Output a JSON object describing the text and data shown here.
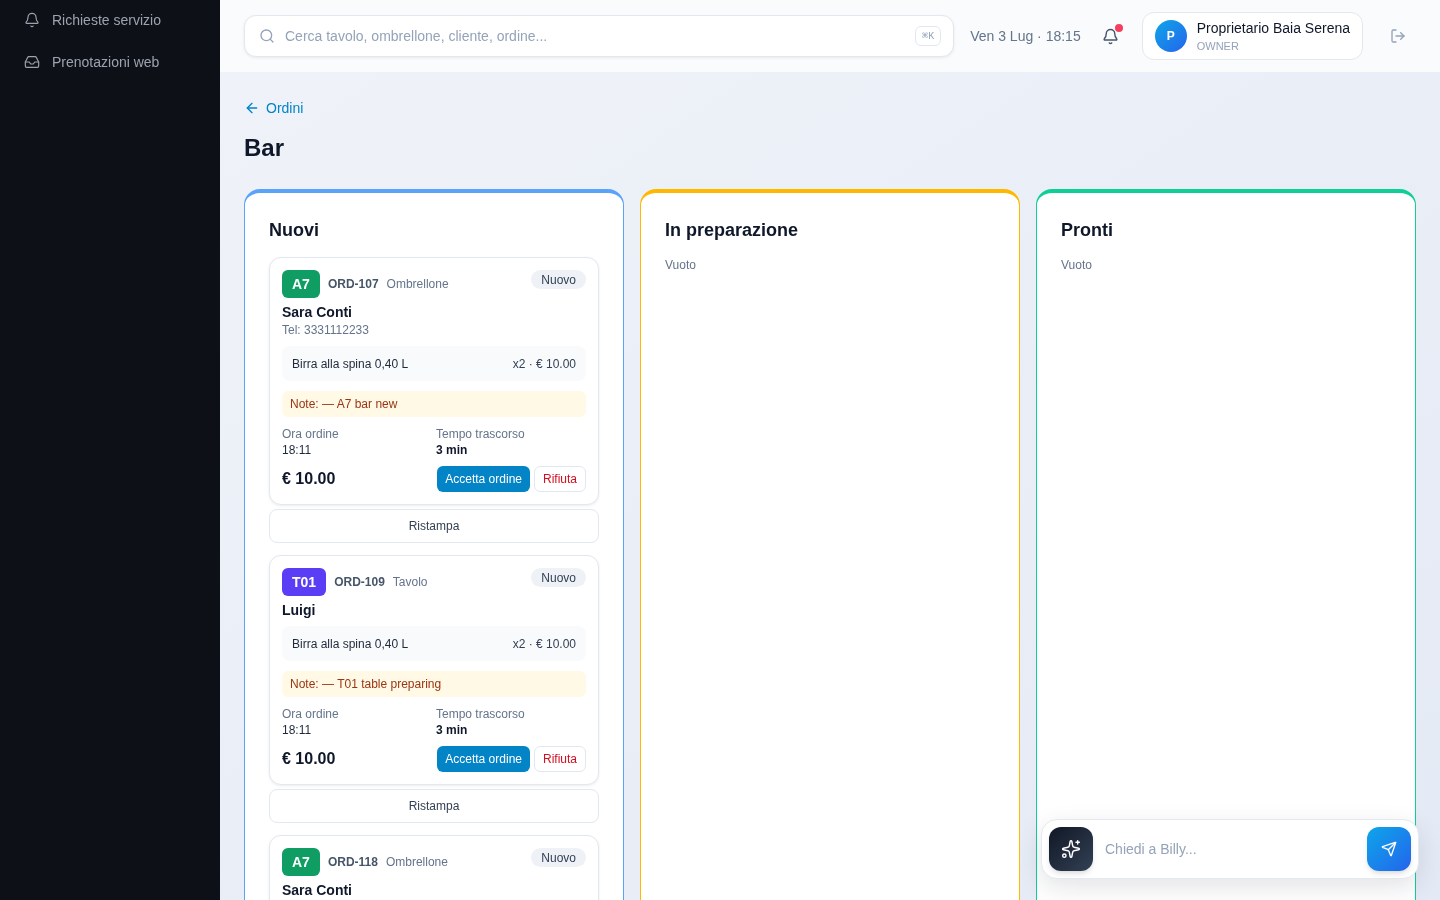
{
  "sidebar": {
    "items": [
      {
        "label": "Richieste servizio"
      },
      {
        "label": "Prenotazioni web"
      }
    ]
  },
  "header": {
    "search": {
      "placeholder": "Cerca tavolo, ombrellone, cliente, ordine...",
      "shortcut": "⌘K"
    },
    "datetime": "Ven 3 Lug · 18:15",
    "notifications": {
      "unread": true
    },
    "user": {
      "initial": "P",
      "name": "Proprietario Baia Serena",
      "role": "OWNER"
    }
  },
  "breadcrumb": {
    "back_link": "Ordini"
  },
  "page_title": "Bar",
  "columns": [
    {
      "title": "Nuovi",
      "color": "#5aa2fa",
      "orders": [
        {
          "badge": "A7",
          "color": "#0f9d63",
          "order_id": "ORD-107",
          "type": "Ombrellone",
          "status": "Nuovo",
          "customer": "Sara Conti",
          "phone": "Tel: 3331112233",
          "items": [
            {
              "name": "Birra alla spina 0,40 L",
              "qty_price": "x2 · € 10.00"
            }
          ],
          "note": "Note: — A7 bar new",
          "order_time": {
            "label": "Ora ordine",
            "value": "18:11"
          },
          "elapsed": {
            "label": "Tempo trascorso",
            "value": "3 min"
          },
          "total": "€ 10.00",
          "actions": [
            {
              "label": "Accetta ordine",
              "kind": "primary"
            },
            {
              "label": "Rifiuta",
              "kind": "danger"
            }
          ],
          "reprint": "Ristampa"
        },
        {
          "badge": "T01",
          "color": "#5a3ef5",
          "order_id": "ORD-109",
          "type": "Tavolo",
          "status": "Nuovo",
          "customer": "Luigi",
          "items": [
            {
              "name": "Birra alla spina 0,40 L",
              "qty_price": "x2 · € 10.00"
            }
          ],
          "note": "Note: — T01 table preparing",
          "order_time": {
            "label": "Ora ordine",
            "value": "18:11"
          },
          "elapsed": {
            "label": "Tempo trascorso",
            "value": "3 min"
          },
          "total": "€ 10.00",
          "actions": [
            {
              "label": "Accetta ordine",
              "kind": "primary"
            },
            {
              "label": "Rifiuta",
              "kind": "danger"
            }
          ],
          "reprint": "Ristampa"
        },
        {
          "badge": "A7",
          "color": "#0f9d63",
          "order_id": "ORD-118",
          "type": "Ombrellone",
          "status": "Nuovo",
          "customer": "Sara Conti"
        }
      ]
    },
    {
      "title": "In preparazione",
      "color": "#ffb800",
      "empty_text": "Vuoto"
    },
    {
      "title": "Pronti",
      "color": "#10cf96",
      "empty_text": "Vuoto"
    }
  ],
  "chat": {
    "placeholder": "Chiedi a Billy..."
  }
}
